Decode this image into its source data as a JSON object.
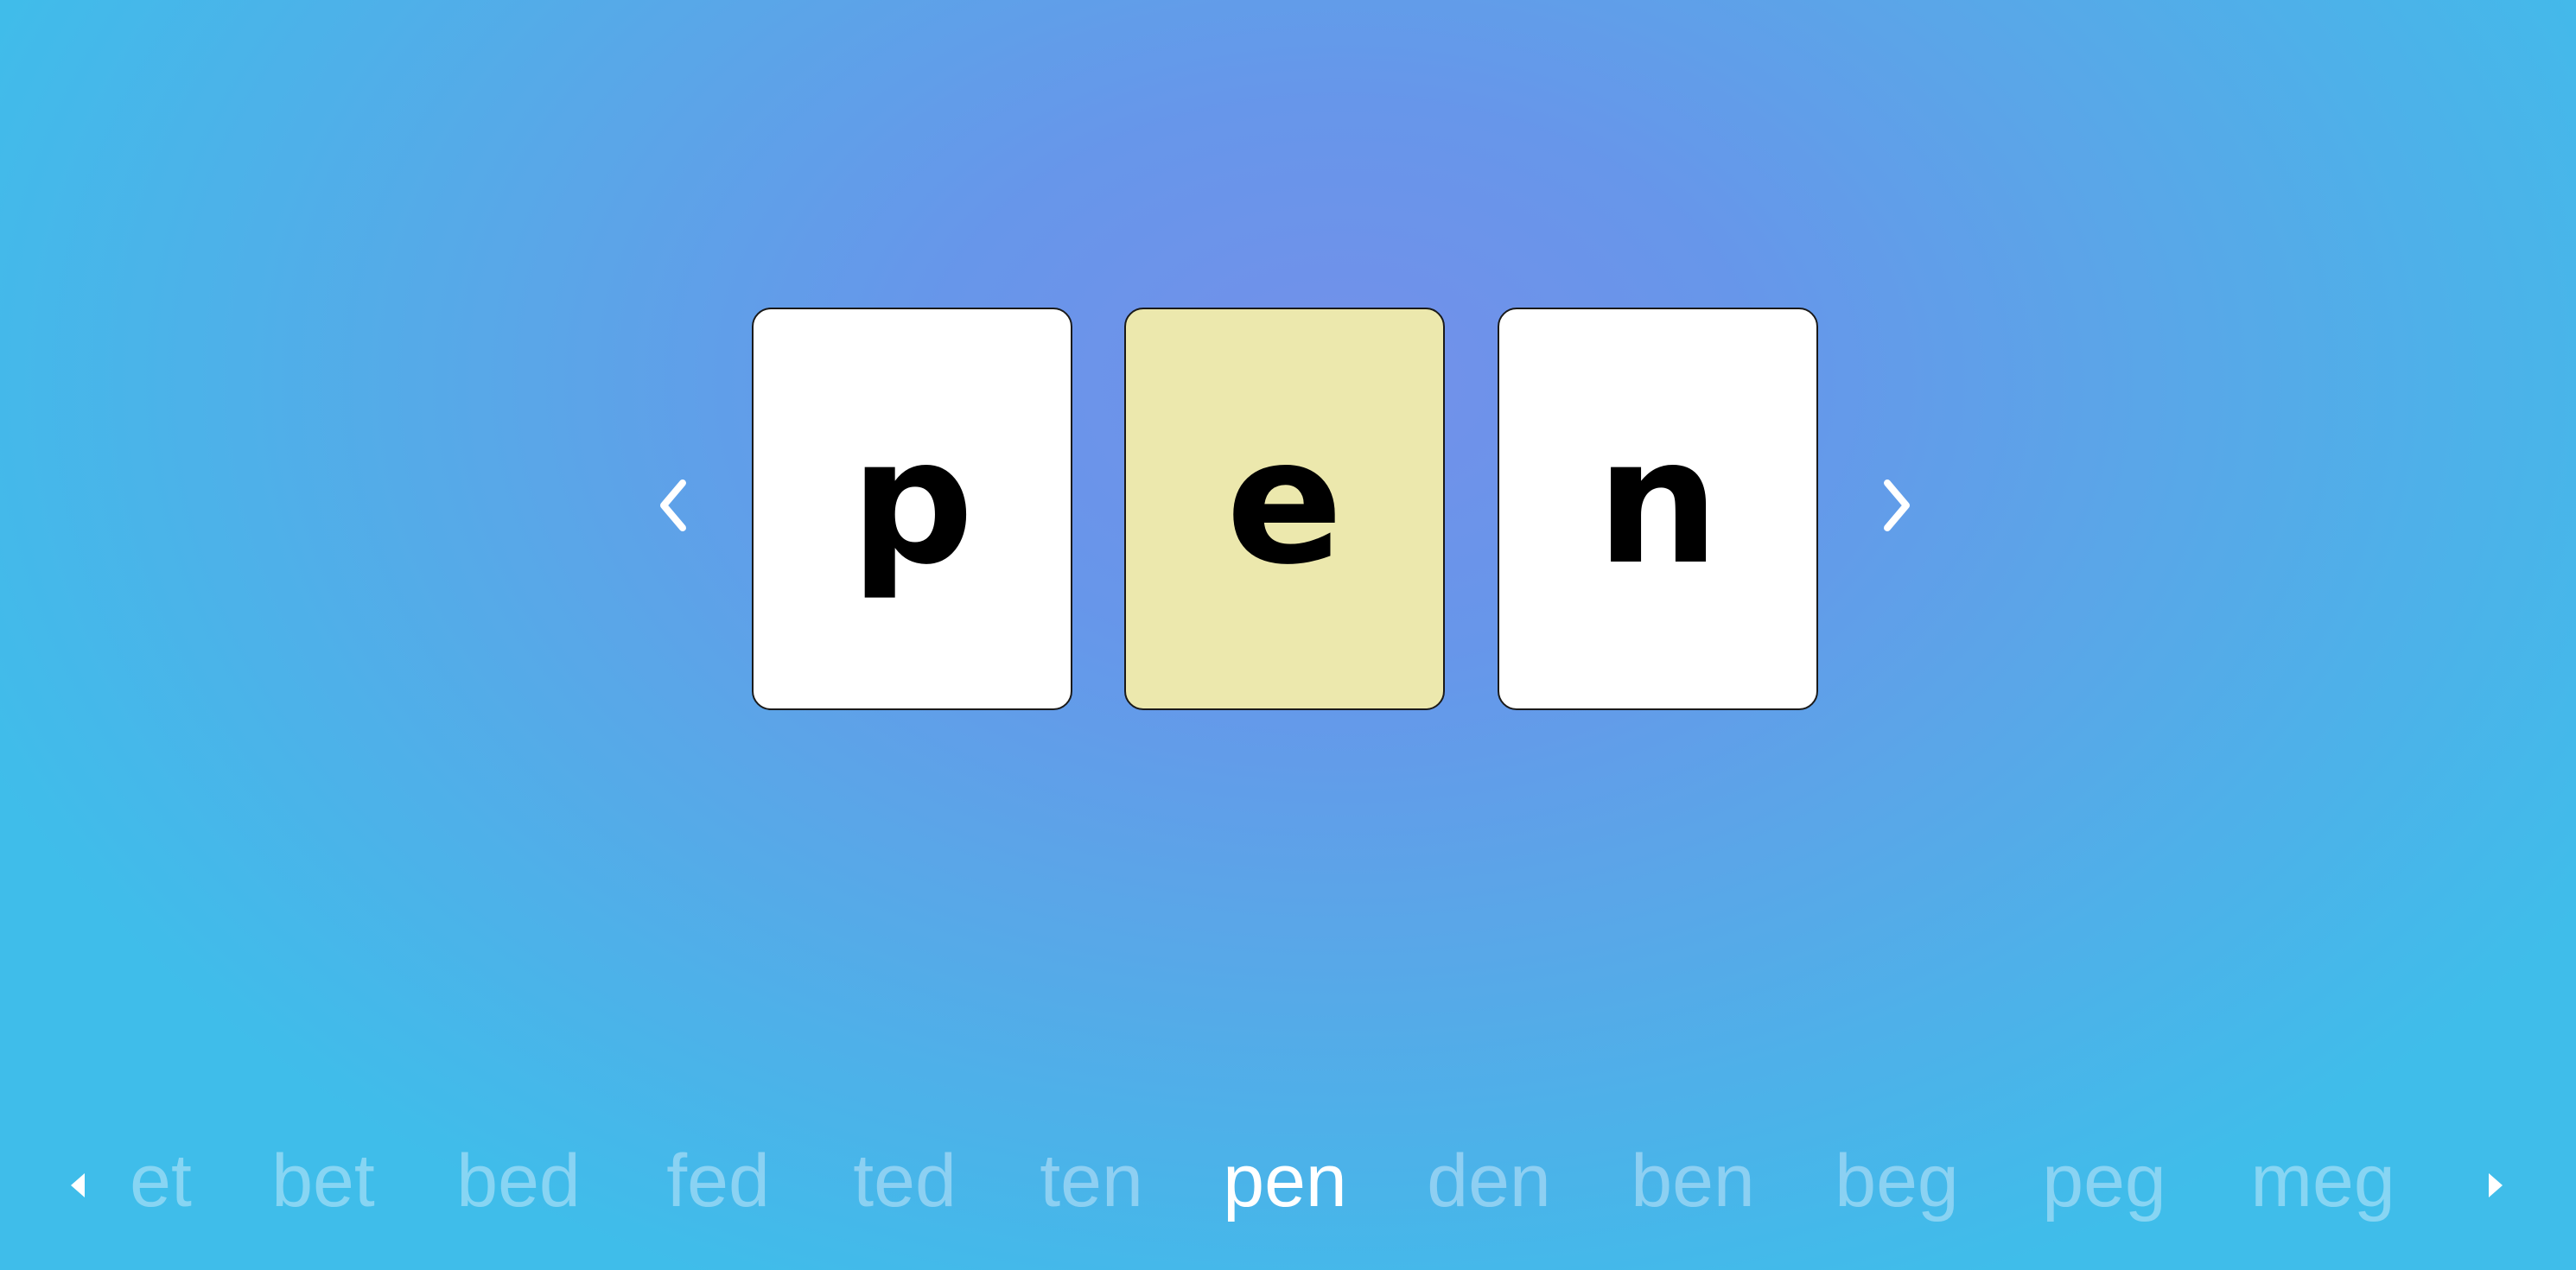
{
  "word": {
    "letters": [
      "p",
      "e",
      "n"
    ],
    "highlight_index": 1,
    "card_colors": {
      "normal": "#ffffff",
      "highlight": "#ece8ad"
    }
  },
  "nav": {
    "prev_icon": "chevron-left-icon",
    "next_icon": "chevron-right-icon",
    "strip_prev_icon": "triangle-left-icon",
    "strip_next_icon": "triangle-right-icon"
  },
  "word_strip": {
    "items": [
      "et",
      "bet",
      "bed",
      "fed",
      "ted",
      "ten",
      "pen",
      "den",
      "ben",
      "beg",
      "peg",
      "meg"
    ],
    "active_index": 6,
    "active_color": "#ffffff",
    "inactive_color": "#a9cdf0"
  }
}
